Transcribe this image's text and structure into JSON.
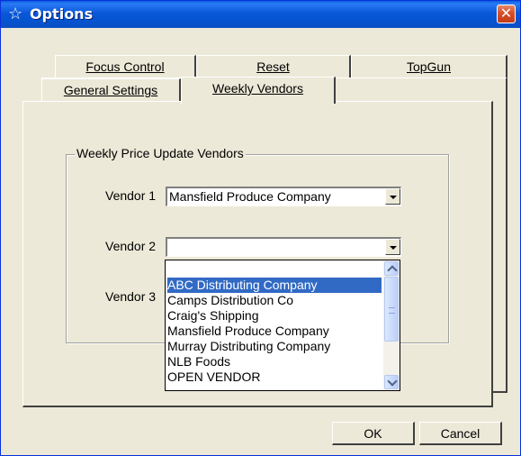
{
  "window": {
    "title": "Options",
    "close_glyph": "✕"
  },
  "tabs": {
    "row_back": [
      "Focus Control",
      "Reset",
      "TopGun"
    ],
    "row_front": [
      "General Settings",
      "Weekly Vendors"
    ],
    "active": "Weekly Vendors"
  },
  "group": {
    "title": "Weekly Price Update Vendors",
    "vendor1_label": "Vendor 1",
    "vendor1_value": "Mansfield Produce Company",
    "vendor2_label": "Vendor 2",
    "vendor2_value": "",
    "vendor3_label": "Vendor 3"
  },
  "dropdown": {
    "items": [
      "",
      "ABC Distributing Company",
      "Camps Distribution Co",
      "Craig's Shipping",
      "Mansfield Produce Company",
      "Murray Distributing Company",
      "NLB Foods",
      "OPEN VENDOR"
    ],
    "selected": "ABC Distributing Company"
  },
  "buttons": {
    "ok": "OK",
    "cancel": "Cancel"
  },
  "icons": {
    "title_icon": "star-outline-icon"
  }
}
